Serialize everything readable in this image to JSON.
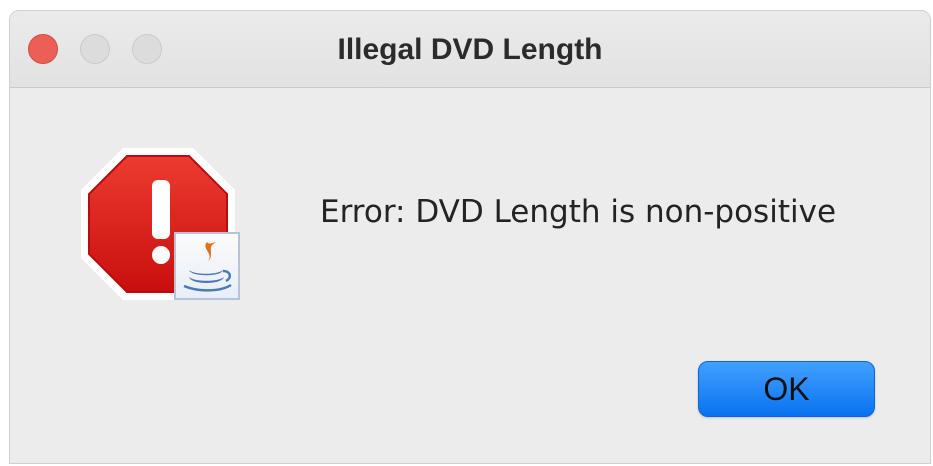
{
  "window": {
    "title": "Illegal DVD Length"
  },
  "dialog": {
    "message": "Error: DVD Length is non-positive",
    "ok_label": "OK",
    "icon": "java-error-alert-icon"
  },
  "colors": {
    "close_button": "#ec5f56",
    "inactive_button": "#dcdcdc",
    "error_red": "#d91a1a",
    "ok_button": "#1e86fb",
    "background": "#ececec"
  }
}
